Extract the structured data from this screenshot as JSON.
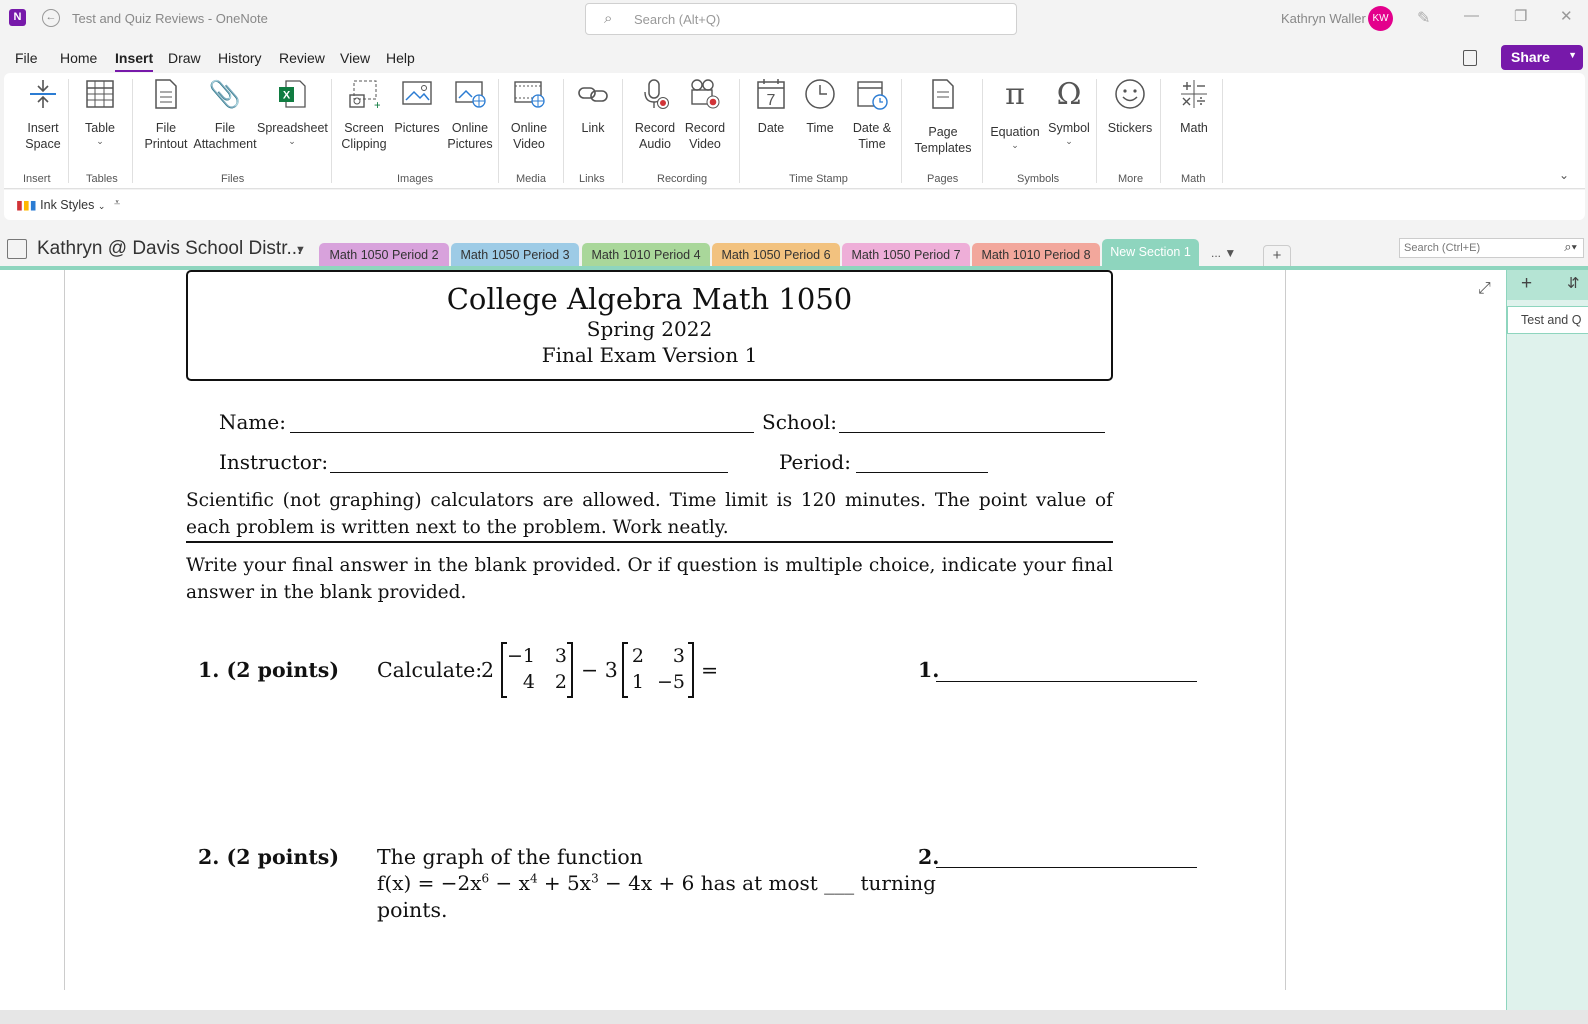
{
  "titlebar": {
    "title": "Test and Quiz Reviews - OneNote",
    "search_placeholder": "Search (Alt+Q)",
    "user_name": "Kathryn Waller",
    "user_initials": "KW",
    "app_icon": "onenote-icon",
    "accent_color": "#7719aa",
    "avatar_color": "#e3008c"
  },
  "menu": {
    "items": [
      "File",
      "Home",
      "Insert",
      "Draw",
      "History",
      "Review",
      "View",
      "Help"
    ],
    "active": "Insert",
    "share_label": "Share"
  },
  "ribbon": {
    "buttons": [
      {
        "label": "Insert\nSpace",
        "icon": "insert-space-icon"
      },
      {
        "label": "Table",
        "icon": "table-icon"
      },
      {
        "label": "File\nPrintout",
        "icon": "file-printout-icon"
      },
      {
        "label": "File\nAttachment",
        "icon": "paperclip-icon"
      },
      {
        "label": "Spreadsheet",
        "icon": "excel-icon"
      },
      {
        "label": "Screen\nClipping",
        "icon": "screen-clipping-icon"
      },
      {
        "label": "Pictures",
        "icon": "pictures-icon"
      },
      {
        "label": "Online\nPictures",
        "icon": "online-pictures-icon"
      },
      {
        "label": "Online\nVideo",
        "icon": "online-video-icon"
      },
      {
        "label": "Link",
        "icon": "link-icon"
      },
      {
        "label": "Record\nAudio",
        "icon": "record-audio-icon"
      },
      {
        "label": "Record\nVideo",
        "icon": "record-video-icon"
      },
      {
        "label": "Date",
        "icon": "calendar-icon"
      },
      {
        "label": "Time",
        "icon": "clock-icon"
      },
      {
        "label": "Date &\nTime",
        "icon": "date-time-icon"
      },
      {
        "label": "Page\nTemplates",
        "icon": "page-templates-icon"
      },
      {
        "label": "Equation",
        "icon": "pi-icon"
      },
      {
        "label": "Symbol",
        "icon": "omega-icon"
      },
      {
        "label": "Stickers",
        "icon": "smiley-icon"
      },
      {
        "label": "Math",
        "icon": "math-operators-icon"
      }
    ],
    "groups": [
      "Insert",
      "Tables",
      "Files",
      "Images",
      "Media",
      "Links",
      "Recording",
      "Time Stamp",
      "Pages",
      "Symbols",
      "More",
      "Math"
    ]
  },
  "inkbar": {
    "ink_styles_label": "Ink Styles"
  },
  "notebook": {
    "name": "Kathryn @ Davis School Distr...",
    "sections": [
      {
        "label": "Math 1050 Period 2",
        "color": "#d8a2dc"
      },
      {
        "label": "Math 1050 Period 3",
        "color": "#9dcbe6"
      },
      {
        "label": "Math 1010 Period 4",
        "color": "#a9d79a"
      },
      {
        "label": "Math 1050 Period 6",
        "color": "#f2c27f"
      },
      {
        "label": "Math 1050 Period 7",
        "color": "#eeaed8"
      },
      {
        "label": "Math 1010 Period 8",
        "color": "#f2a79c"
      },
      {
        "label": "New Section 1",
        "color": "#8ed5be"
      }
    ],
    "more_label": "...",
    "page_search_placeholder": "Search (Ctrl+E)"
  },
  "page_panel": {
    "pages": [
      "Test and Q"
    ]
  },
  "exam": {
    "title": "College Algebra Math 1050",
    "term": "Spring 2022",
    "version": "Final Exam Version 1",
    "name_label": "Name:",
    "school_label": "School:",
    "instructor_label": "Instructor:",
    "period_label": "Period:",
    "instructions1": "Scientific (not graphing) calculators are allowed. Time limit is 120 minutes. The point value of each problem is written next to the problem. Work neatly.",
    "instructions2": "Write your final answer in the blank provided. Or if question is multiple choice, indicate your final answer in the blank provided.",
    "q1": {
      "number": "1. (2 points)",
      "prefix": "Calculate:",
      "coef1": "2",
      "matrix1": [
        "−1",
        "3",
        "4",
        "2"
      ],
      "op": "− 3",
      "matrix2": [
        "2",
        "3",
        "1",
        "−5"
      ],
      "eq": "=",
      "answer_label": "1."
    },
    "q2": {
      "number": "2. (2 points)",
      "line1": "The graph of the function",
      "line2_prefix": "f(x) = −2x",
      "exp6": "6",
      "mid1": " − x",
      "exp4": "4",
      "mid2": " + 5x",
      "exp3": "3",
      "line2_suffix": " − 4x + 6 has at most ___ turning",
      "line3": "points.",
      "answer_label": "2."
    }
  }
}
